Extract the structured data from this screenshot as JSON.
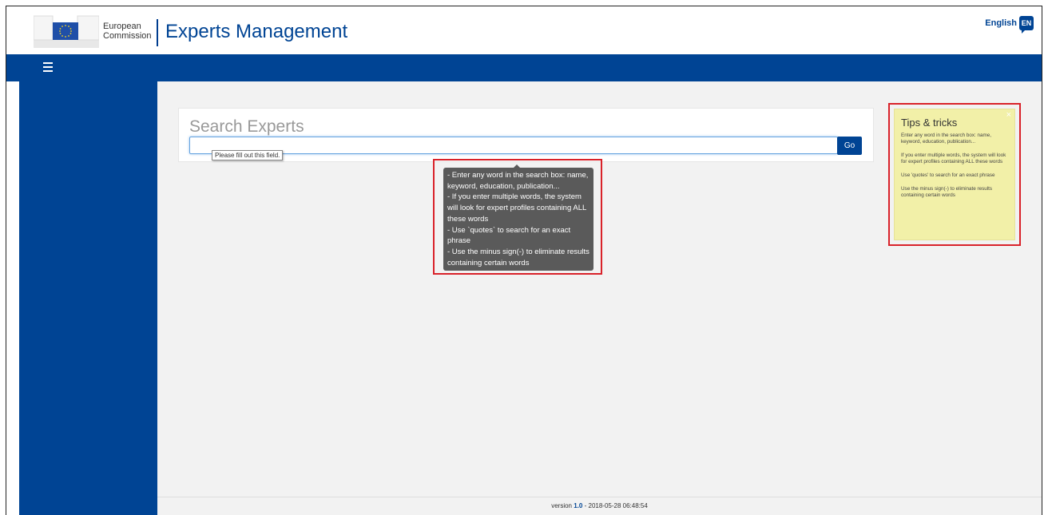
{
  "header": {
    "logo_line1": "European",
    "logo_line2": "Commission",
    "app_title": "Experts Management",
    "language_label": "English",
    "language_code": "EN"
  },
  "nav": {
    "menu_icon": "hamburger-menu-icon"
  },
  "search": {
    "title": "Search Experts",
    "input_value": "",
    "go_label": "Go",
    "validation_message": "Please fill out this field."
  },
  "tooltip": {
    "lines": [
      "- Enter any word in the search box: name, keyword, education, publication...",
      "- If you enter multiple words, the system will look for expert profiles containing ALL these words",
      "- Use `quotes` to search for an exact phrase",
      "- Use the minus sign(-) to eliminate results containing certain words"
    ]
  },
  "tips": {
    "title": "Tips & tricks",
    "close": "×",
    "items": [
      "Enter any word in the search box: name, keyword, education, publication...",
      "If you enter multiple words, the system will look for expert profiles containing ALL these words",
      "Use 'quotes' to search for an exact phrase",
      "Use the minus sign(-) to eliminate results containing certain words"
    ]
  },
  "footer": {
    "prefix": "version",
    "version": "1.0",
    "suffix": "- 2018-05-28 06:48:54"
  },
  "colors": {
    "brand_blue": "#004494",
    "tips_yellow": "#f2f0a8",
    "highlight_red": "#d9222a"
  }
}
